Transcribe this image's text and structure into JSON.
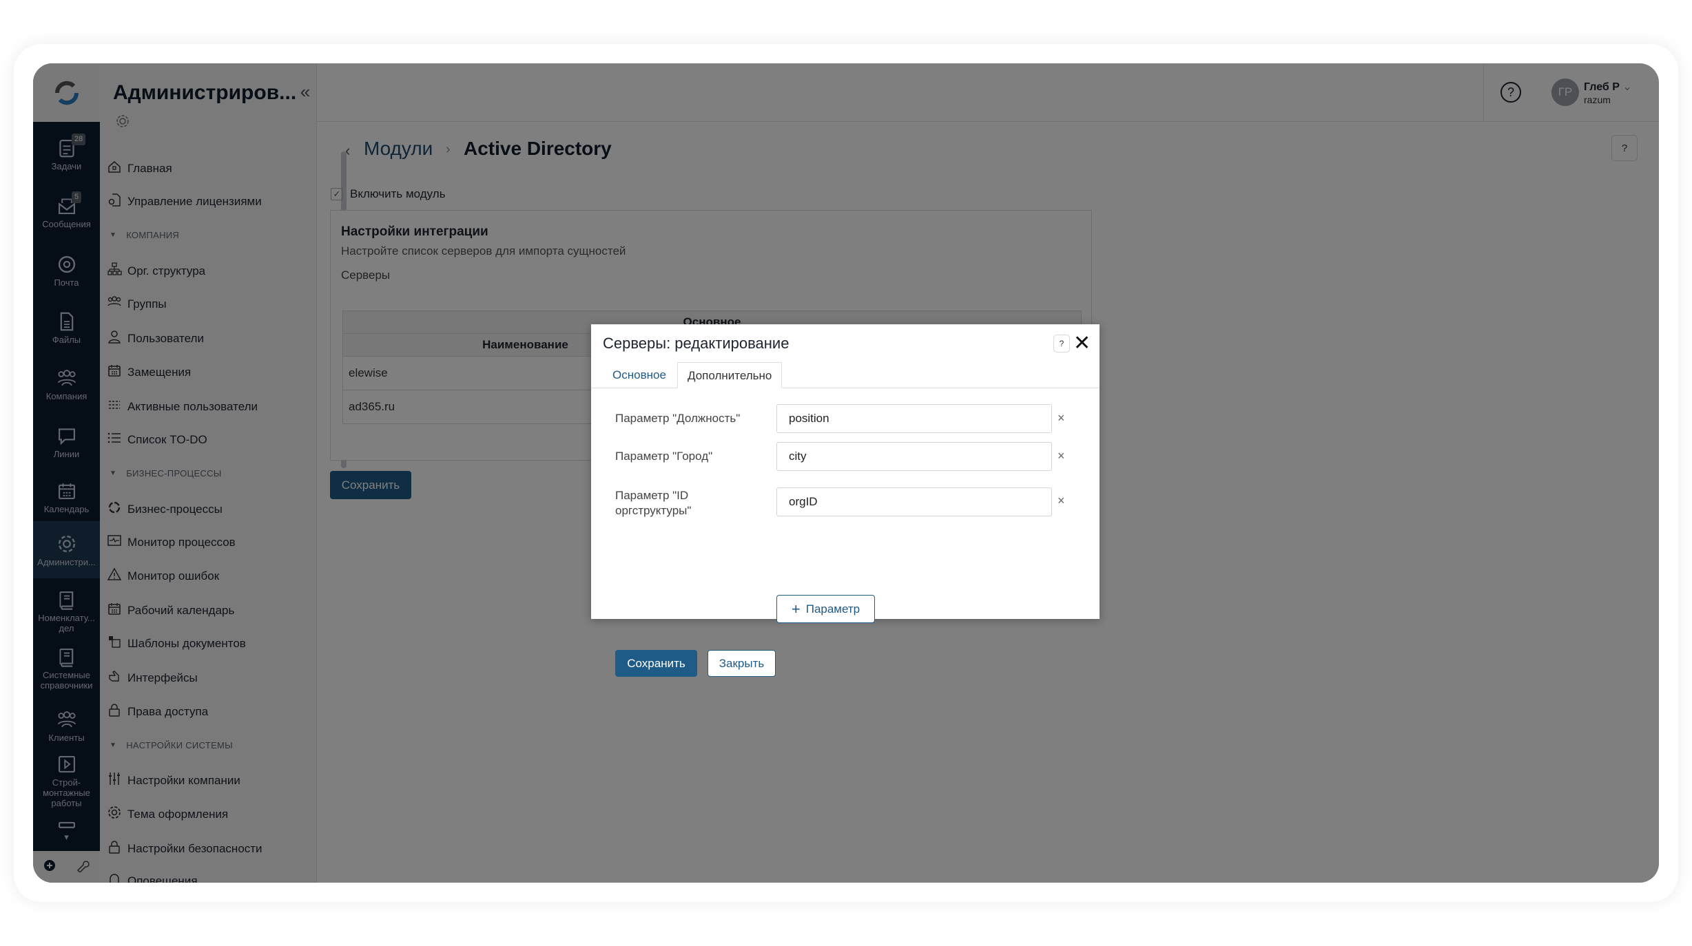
{
  "rail": {
    "items": [
      {
        "label": "Задачи",
        "icon": "tasks-icon",
        "badge": "28"
      },
      {
        "label": "Сообщения",
        "icon": "messages-icon",
        "badge": "5"
      },
      {
        "label": "Почта",
        "icon": "mail-icon"
      },
      {
        "label": "Файлы",
        "icon": "files-icon"
      },
      {
        "label": "Компания",
        "icon": "company-icon"
      },
      {
        "label": "Линии",
        "icon": "chat-icon"
      },
      {
        "label": "Календарь",
        "icon": "calendar-icon"
      },
      {
        "label": "Администри...",
        "icon": "gear-icon",
        "active": true
      },
      {
        "label": "Номенклату... дел",
        "icon": "book-icon"
      },
      {
        "label": "Системные справочники",
        "icon": "book-icon"
      },
      {
        "label": "Клиенты",
        "icon": "clients-icon"
      },
      {
        "label": "Строй-монтажные работы",
        "icon": "play-icon"
      },
      {
        "label": "",
        "icon": "sofa-icon"
      }
    ]
  },
  "nav": {
    "title": "Администриров...",
    "items": [
      {
        "type": "item",
        "label": "Главная",
        "icon": "home-icon"
      },
      {
        "type": "item",
        "label": "Управление лицензиями",
        "icon": "license-icon"
      },
      {
        "type": "section",
        "label": "КОМПАНИЯ"
      },
      {
        "type": "item",
        "label": "Орг. структура",
        "icon": "org-icon"
      },
      {
        "type": "item",
        "label": "Группы",
        "icon": "groups-icon"
      },
      {
        "type": "item",
        "label": "Пользователи",
        "icon": "user-icon"
      },
      {
        "type": "item",
        "label": "Замещения",
        "icon": "calendar-icon"
      },
      {
        "type": "item",
        "label": "Активные пользователи",
        "icon": "active-users-icon"
      },
      {
        "type": "item",
        "label": "Список TO-DO",
        "icon": "list-icon"
      },
      {
        "type": "section",
        "label": "БИЗНЕС-ПРОЦЕССЫ"
      },
      {
        "type": "item",
        "label": "Бизнес-процессы",
        "icon": "cycle-icon"
      },
      {
        "type": "item",
        "label": "Монитор процессов",
        "icon": "monitor-icon"
      },
      {
        "type": "item",
        "label": "Монитор ошибок",
        "icon": "warning-icon"
      },
      {
        "type": "item",
        "label": "Рабочий календарь",
        "icon": "calendar-icon"
      },
      {
        "type": "item",
        "label": "Шаблоны документов",
        "icon": "templates-icon"
      },
      {
        "type": "item",
        "label": "Интерфейсы",
        "icon": "hand-icon"
      },
      {
        "type": "item",
        "label": "Права доступа",
        "icon": "lock-icon"
      },
      {
        "type": "section",
        "label": "НАСТРОЙКИ СИСТЕМЫ"
      },
      {
        "type": "item",
        "label": "Настройки компании",
        "icon": "sliders-icon"
      },
      {
        "type": "item",
        "label": "Тема оформления",
        "icon": "gear-icon"
      },
      {
        "type": "item",
        "label": "Настройки безопасности",
        "icon": "lock-icon"
      },
      {
        "type": "item",
        "label": "Оповещения",
        "icon": "bell-icon"
      }
    ]
  },
  "header": {
    "user_name": "Глеб Р",
    "user_login": "razum",
    "avatar_initials": "ГР"
  },
  "breadcrumb": {
    "parent": "Модули",
    "current": "Active Directory"
  },
  "page": {
    "enable_module": "Включить модуль",
    "enable_checked": true,
    "card_title": "Настройки интеграции",
    "card_subtitle": "Настройте список серверов для импорта сущностей",
    "servers_label": "Серверы",
    "table": {
      "group_header": "Основное",
      "columns": [
        "Наименование"
      ],
      "rows": [
        [
          "elewise"
        ],
        [
          "ad365.ru"
        ]
      ]
    },
    "save_label": "Сохранить"
  },
  "modal": {
    "title": "Серверы: редактирование",
    "tabs": [
      {
        "label": "Основное"
      },
      {
        "label": "Дополнительно",
        "active": true
      }
    ],
    "fields": [
      {
        "label": "Параметр \"Должность\"",
        "value": "position"
      },
      {
        "label": "Параметр \"Город\"",
        "value": "city"
      },
      {
        "label": "Параметр \"ID оргструктуры\"",
        "value": "orgID"
      }
    ],
    "add_param_label": "Параметр",
    "save_label": "Сохранить",
    "close_label": "Закрыть"
  },
  "colors": {
    "accent": "#1f5b87",
    "rail_bg": "#0b1a2e",
    "rail_active": "#1e3a55"
  }
}
